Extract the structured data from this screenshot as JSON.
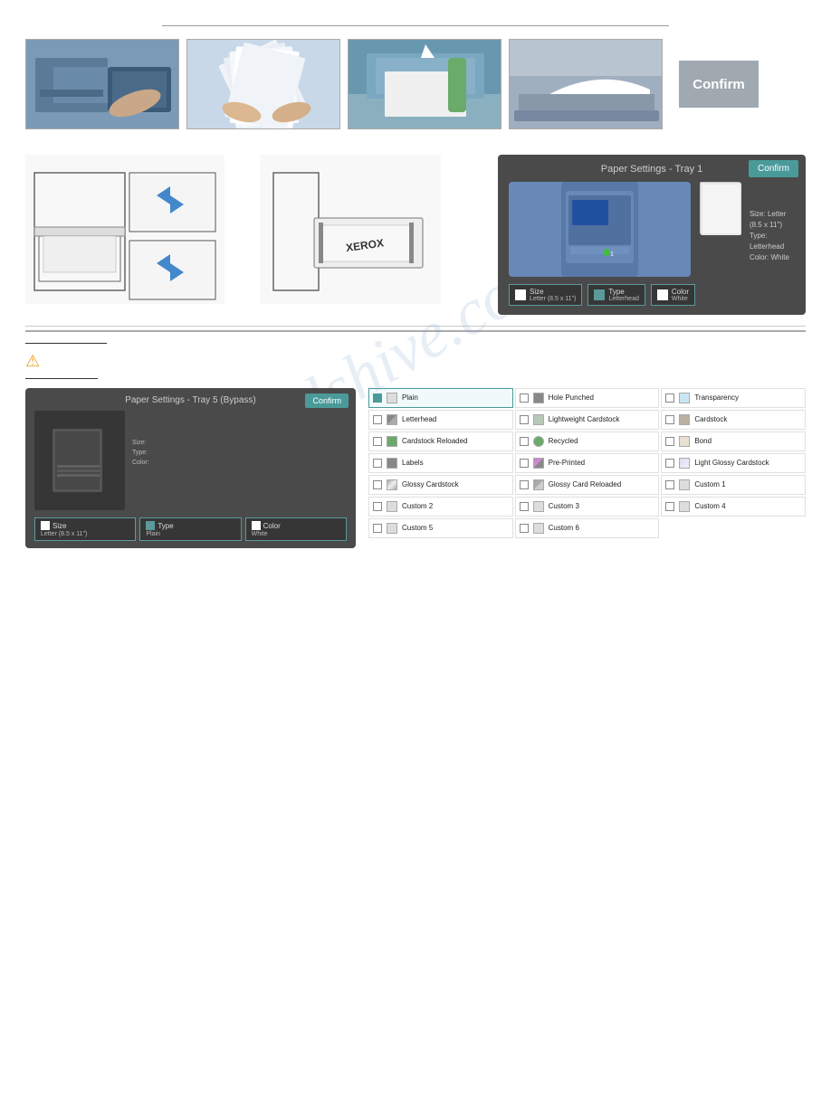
{
  "top": {
    "confirm_label": "Confirm",
    "photos": [
      {
        "id": "photo1",
        "alt": "Person loading paper tray"
      },
      {
        "id": "photo2",
        "alt": "Fanning paper sheets"
      },
      {
        "id": "photo3",
        "alt": "Paper in tray slot"
      },
      {
        "id": "photo4",
        "alt": "Paper in output tray"
      }
    ]
  },
  "middle": {
    "watermark": "manualshive.com",
    "settings_panel": {
      "title": "Paper Settings - Tray 1",
      "confirm_label": "Confirm",
      "size_label": "Size",
      "size_value": "Letter (8.5 x 11\")",
      "type_label": "Type",
      "type_value": "Letterhead",
      "color_label": "Color",
      "color_value": "White",
      "info_size": "Size: Letter (8.5 x 11\")",
      "info_type": "Type: Letterhead",
      "info_color": "Color: White"
    }
  },
  "bottom": {
    "warning_icon": "⚠",
    "bypass_panel": {
      "title": "Paper Settings - Tray 5 (Bypass)",
      "confirm_label": "Confirm",
      "size_label": "Size:",
      "size_value": "",
      "type_label": "Type:",
      "type_value": "",
      "color_label": "Color:",
      "color_value": "",
      "footer_size_label": "Size",
      "footer_size_value": "Letter (8.5 x 11\")",
      "footer_type_label": "Type",
      "footer_type_value": "Plain",
      "footer_color_label": "Color",
      "footer_color_value": "White"
    },
    "paper_types": [
      {
        "label": "Plain",
        "icon": "plain",
        "highlighted": true
      },
      {
        "label": "Hole Punched",
        "icon": "hole-punched",
        "highlighted": false
      },
      {
        "label": "Transparency",
        "icon": "transparency",
        "highlighted": false
      },
      {
        "label": "Letterhead",
        "icon": "letterhead",
        "highlighted": false
      },
      {
        "label": "Lightweight Cardstock",
        "icon": "lightweight",
        "highlighted": false
      },
      {
        "label": "Cardstock",
        "icon": "cardstock",
        "highlighted": false
      },
      {
        "label": "Cardstock Reloaded",
        "icon": "cardstock-reload",
        "highlighted": false
      },
      {
        "label": "Recycled",
        "icon": "recycled",
        "highlighted": false
      },
      {
        "label": "Bond",
        "icon": "bond",
        "highlighted": false
      },
      {
        "label": "Labels",
        "icon": "labels",
        "highlighted": false
      },
      {
        "label": "Pre-Printed",
        "icon": "pre-printed",
        "highlighted": false
      },
      {
        "label": "Light Glossy Cardstock",
        "icon": "light-glossy",
        "highlighted": false
      },
      {
        "label": "Glossy Cardstock",
        "icon": "glossy",
        "highlighted": false
      },
      {
        "label": "Glossy Card Reloaded",
        "icon": "glossy-card-reload",
        "highlighted": false
      },
      {
        "label": "Custom 1",
        "icon": "custom",
        "highlighted": false
      },
      {
        "label": "Custom 2",
        "icon": "custom",
        "highlighted": false
      },
      {
        "label": "Custom 3",
        "icon": "custom",
        "highlighted": false
      },
      {
        "label": "Custom 4",
        "icon": "custom",
        "highlighted": false
      },
      {
        "label": "Custom 5",
        "icon": "custom",
        "highlighted": false
      },
      {
        "label": "Custom 6",
        "icon": "custom",
        "highlighted": false
      }
    ]
  }
}
